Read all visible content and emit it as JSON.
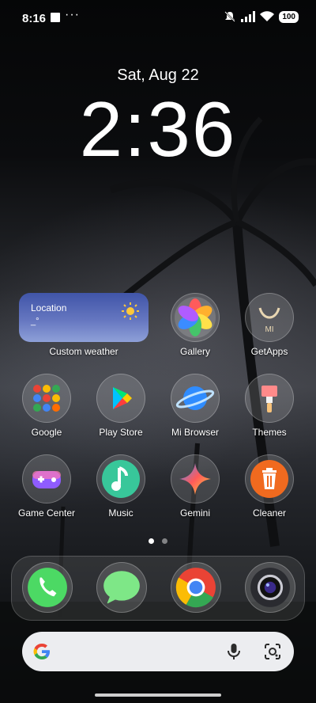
{
  "status_bar": {
    "time": "8:16",
    "more": "···",
    "battery": "100"
  },
  "lockclock": {
    "date": "Sat, Aug 22",
    "time": "2:36"
  },
  "weather_widget": {
    "location": "Location",
    "temperature": "_°",
    "label": "Custom weather"
  },
  "apps": {
    "gallery": "Gallery",
    "getapps": "GetApps",
    "google": "Google",
    "play_store": "Play Store",
    "mi_browser": "Mi Browser",
    "themes": "Themes",
    "game_center": "Game Center",
    "music": "Music",
    "gemini": "Gemini",
    "cleaner": "Cleaner"
  },
  "getapps_logo": "MI",
  "page_indicator": {
    "pages": 2,
    "current": 1
  },
  "dock": [
    "Phone",
    "Messaging",
    "Chrome",
    "Camera"
  ],
  "search_bar": {
    "logo": "google-g-icon",
    "mic": "mic-icon",
    "lens": "lens-icon"
  },
  "colors": {
    "weather_top": "#4055a8",
    "search_bg": "#ecedf0",
    "cleaner": "#f06a1f",
    "phone": "#4cd964"
  }
}
